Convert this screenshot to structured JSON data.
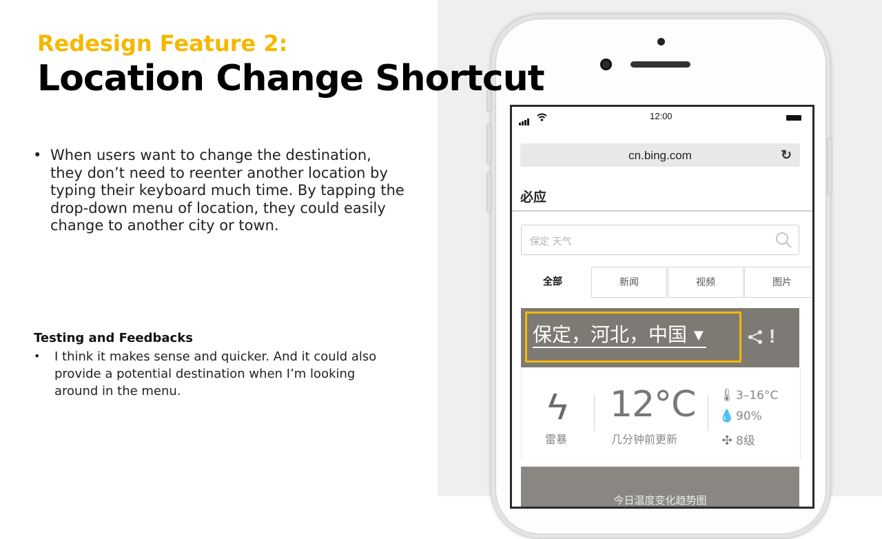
{
  "slide": {
    "subtitle": "Redesign Feature 2:",
    "title": "Location Change Shortcut",
    "bullets": [
      "When users want to change the destination, they don’t need to reenter another location by typing their keyboard much time. By tapping the drop-down menu of location, they could easily change to another city or town."
    ],
    "feedback_heading": "Testing and Feedbacks",
    "feedback_items": [
      "I think it makes sense and quicker. And it could also provide a potential destination when I’m looking around in the menu."
    ]
  },
  "phone": {
    "status_time": "12:00",
    "url": "cn.bing.com",
    "brand": "必应",
    "search_placeholder": "保定 天气",
    "tabs": [
      "全部",
      "新闻",
      "视频",
      "图片"
    ],
    "location": "保定，河北，中国",
    "condition": "雷暴",
    "temperature": "12°C",
    "updated": "几分钟前更新",
    "temp_range": "3–16°C",
    "humidity": "90%",
    "wind": "8级",
    "bottom_text": "今日温度变化趋势图"
  },
  "colors": {
    "accent": "#f5b800",
    "weather_header": "#7d7a74"
  }
}
